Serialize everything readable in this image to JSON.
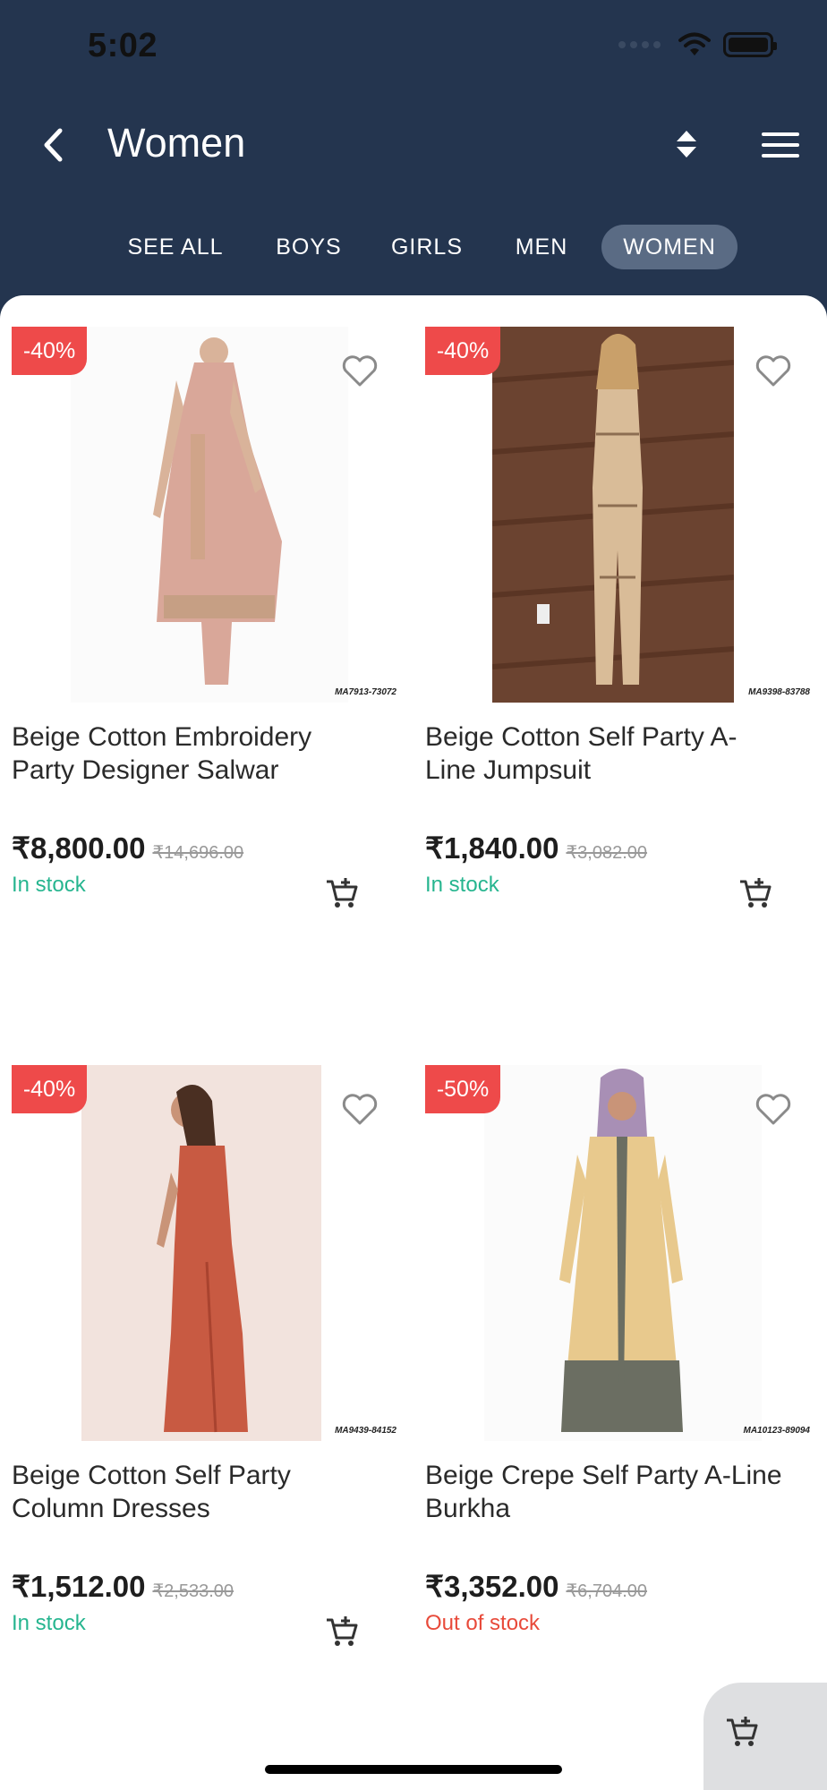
{
  "status_bar": {
    "time": "5:02"
  },
  "header": {
    "title": "Women"
  },
  "tabs": [
    {
      "label": "SEE ALL",
      "active": false
    },
    {
      "label": "BOYS",
      "active": false
    },
    {
      "label": "GIRLS",
      "active": false
    },
    {
      "label": "MEN",
      "active": false
    },
    {
      "label": "WOMEN",
      "active": true
    }
  ],
  "products": [
    {
      "badge": "-40%",
      "title": "Beige Cotton Embroidery Party Designer Salwar",
      "price": "₹8,800.00",
      "old_price": "₹14,696.00",
      "stock": "In stock",
      "in_stock": true,
      "code": "MA7913-73072"
    },
    {
      "badge": "-40%",
      "title": "Beige Cotton Self Party A-Line Jumpsuit",
      "price": "₹1,840.00",
      "old_price": "₹3,082.00",
      "stock": "In stock",
      "in_stock": true,
      "code": "MA9398-83788"
    },
    {
      "badge": "-40%",
      "title": "Beige Cotton Self Party Column Dresses",
      "price": "₹1,512.00",
      "old_price": "₹2,533.00",
      "stock": "In stock",
      "in_stock": true,
      "code": "MA9439-84152"
    },
    {
      "badge": "-50%",
      "title": "Beige Crepe Self Party A-Line Burkha",
      "price": "₹3,352.00",
      "old_price": "₹6,704.00",
      "stock": "Out of stock",
      "in_stock": false,
      "code": "MA10123-89094"
    }
  ],
  "icons": {
    "back": "chevron-left-icon",
    "sort": "sort-icon",
    "menu": "hamburger-menu-icon",
    "wishlist": "heart-outline-icon",
    "add_to_cart": "cart-plus-icon"
  },
  "colors": {
    "header_bg": "#24354f",
    "active_tab_bg": "#5a6b84",
    "badge": "#ee4a4a",
    "in_stock": "#26b58f",
    "out_of_stock": "#e84a3a"
  }
}
